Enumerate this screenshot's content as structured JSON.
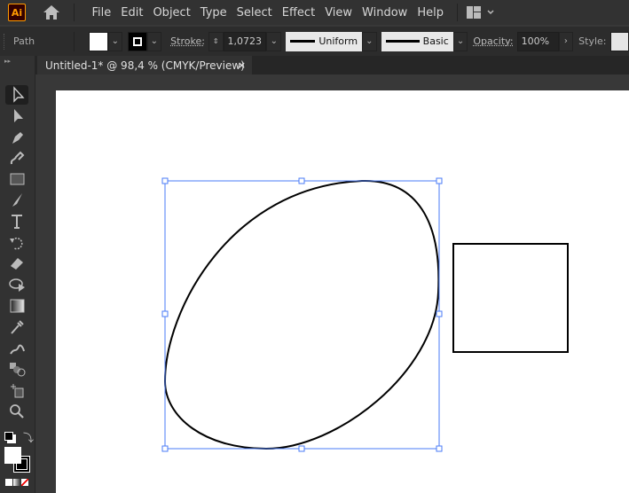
{
  "app": {
    "logo": "Ai"
  },
  "menu": [
    "File",
    "Edit",
    "Object",
    "Type",
    "Select",
    "Effect",
    "View",
    "Window",
    "Help"
  ],
  "control": {
    "object_type": "Path",
    "stroke_label": "Stroke:",
    "stroke_weight": "1,0723 pt",
    "variable_width": "Uniform",
    "brush": "Basic",
    "opacity_label": "Opacity:",
    "opacity": "100%",
    "style_label": "Style:"
  },
  "document": {
    "tab_title": "Untitled-1* @ 98,4 % (CMYK/Preview)",
    "close": "×"
  },
  "tools": [
    "selection-tool",
    "direct-selection-tool",
    "pen-tool",
    "curvature-tool",
    "rectangle-tool",
    "paintbrush-tool",
    "type-tool",
    "rotate-tool",
    "eraser-tool",
    "shape-builder-tool",
    "gradient-tool",
    "eyedropper-tool",
    "puppet-warp-tool",
    "blend-tool",
    "artboard-tool",
    "zoom-tool"
  ],
  "colors": {
    "selection": "#4a7bf7",
    "fill": "#ffffff",
    "stroke": "#000000"
  }
}
